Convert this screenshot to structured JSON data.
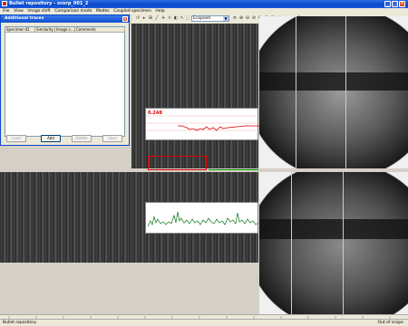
{
  "window": {
    "title": "Bullet repository - scorp_001_2"
  },
  "menu": [
    "File",
    "View",
    "Image shift",
    "Comparison mode",
    "Modes",
    "Coupled specimen",
    "Help"
  ],
  "toolbar": {
    "scale_value": "Ecopiam"
  },
  "dialog": {
    "title": "Additional traces",
    "columns": [
      "Specimen ID",
      "Similarity",
      "Image c...",
      "Comments"
    ],
    "buttons": {
      "load": "Load",
      "add": "Add",
      "delete": "Delete",
      "save": "Save"
    }
  },
  "graph": {
    "value_label": "0.248"
  },
  "status": {
    "left": "Bullet repository",
    "right": "Out of scope"
  },
  "colors": {
    "title": "#0a48c9",
    "trace_red": "#e00000",
    "trace_green": "#0a7a1a"
  }
}
